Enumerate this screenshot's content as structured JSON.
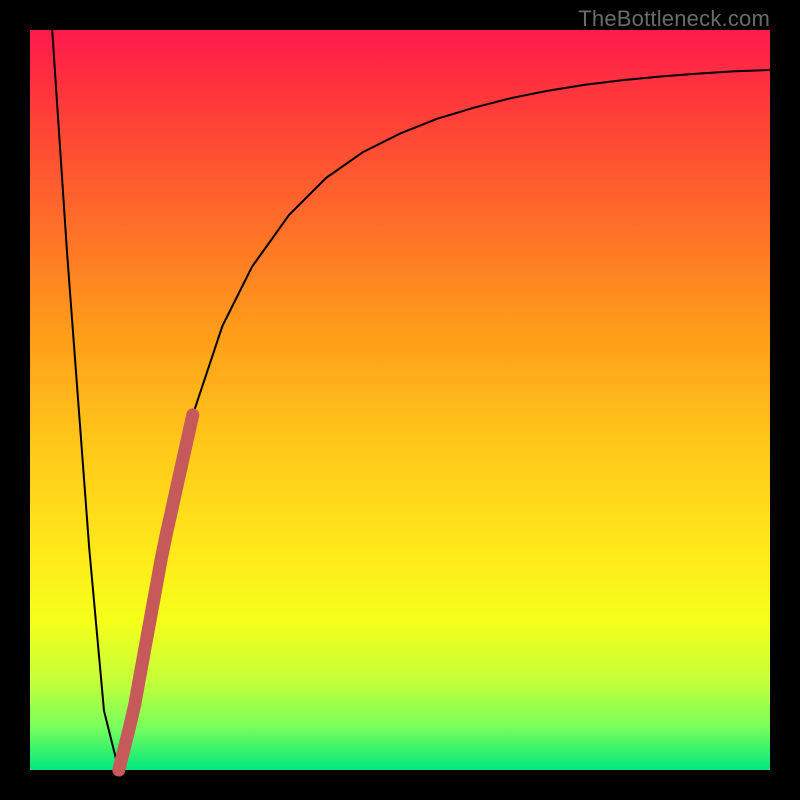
{
  "watermark": "TheBottleneck.com",
  "colors": {
    "frame_bg": "#000000",
    "gradient_top": "#ff1a4b",
    "gradient_bottom": "#00e87d",
    "curve": "#000000",
    "marker": "#c65a5a"
  },
  "chart_data": {
    "type": "line",
    "title": "",
    "xlabel": "",
    "ylabel": "",
    "xlim": [
      0,
      100
    ],
    "ylim": [
      0,
      100
    ],
    "series": [
      {
        "name": "bottleneck-curve",
        "x": [
          3,
          5,
          8,
          10,
          12,
          14,
          18,
          22,
          26,
          30,
          35,
          40,
          45,
          50,
          55,
          60,
          65,
          70,
          75,
          80,
          85,
          90,
          95,
          100
        ],
        "y": [
          100,
          70,
          30,
          8,
          0,
          8,
          30,
          48,
          60,
          68,
          75,
          80,
          83.5,
          86,
          88,
          89.5,
          90.8,
          91.8,
          92.6,
          93.2,
          93.7,
          94.1,
          94.4,
          94.6
        ]
      }
    ],
    "annotations": [
      {
        "name": "highlight-segment",
        "x_range": [
          12,
          22
        ],
        "note": "thick salmon segment on rising branch near minimum"
      }
    ]
  }
}
